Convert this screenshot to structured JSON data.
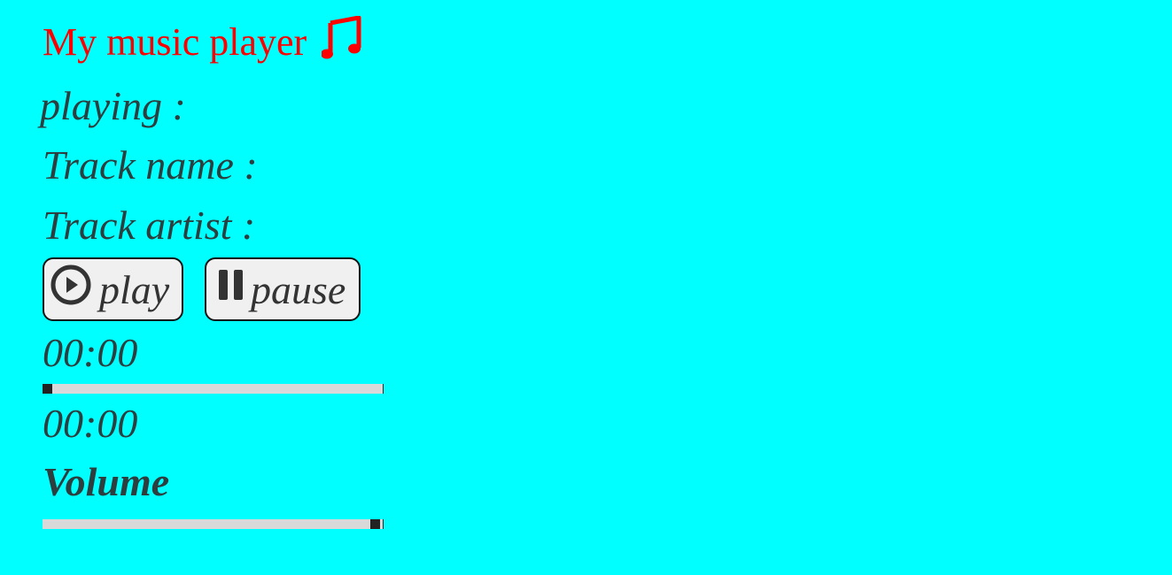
{
  "header": {
    "title": "My music player",
    "icon": "music-note-icon"
  },
  "info": {
    "playing_label": "playing :",
    "track_name_label": "Track name :",
    "track_artist_label": "Track artist :"
  },
  "controls": {
    "play_label": "play",
    "play_icon": "play-circle-icon",
    "pause_label": "pause",
    "pause_icon": "pause-icon"
  },
  "time": {
    "current": "00:00",
    "duration": "00:00"
  },
  "seek": {
    "progress": 0
  },
  "volume": {
    "label": "Volume",
    "level": 1.0
  },
  "colors": {
    "background": "#00ffff",
    "title": "#ff0000",
    "button_bg": "#f0f0f0",
    "track": "#d9d9d9",
    "thumb": "#222222"
  }
}
